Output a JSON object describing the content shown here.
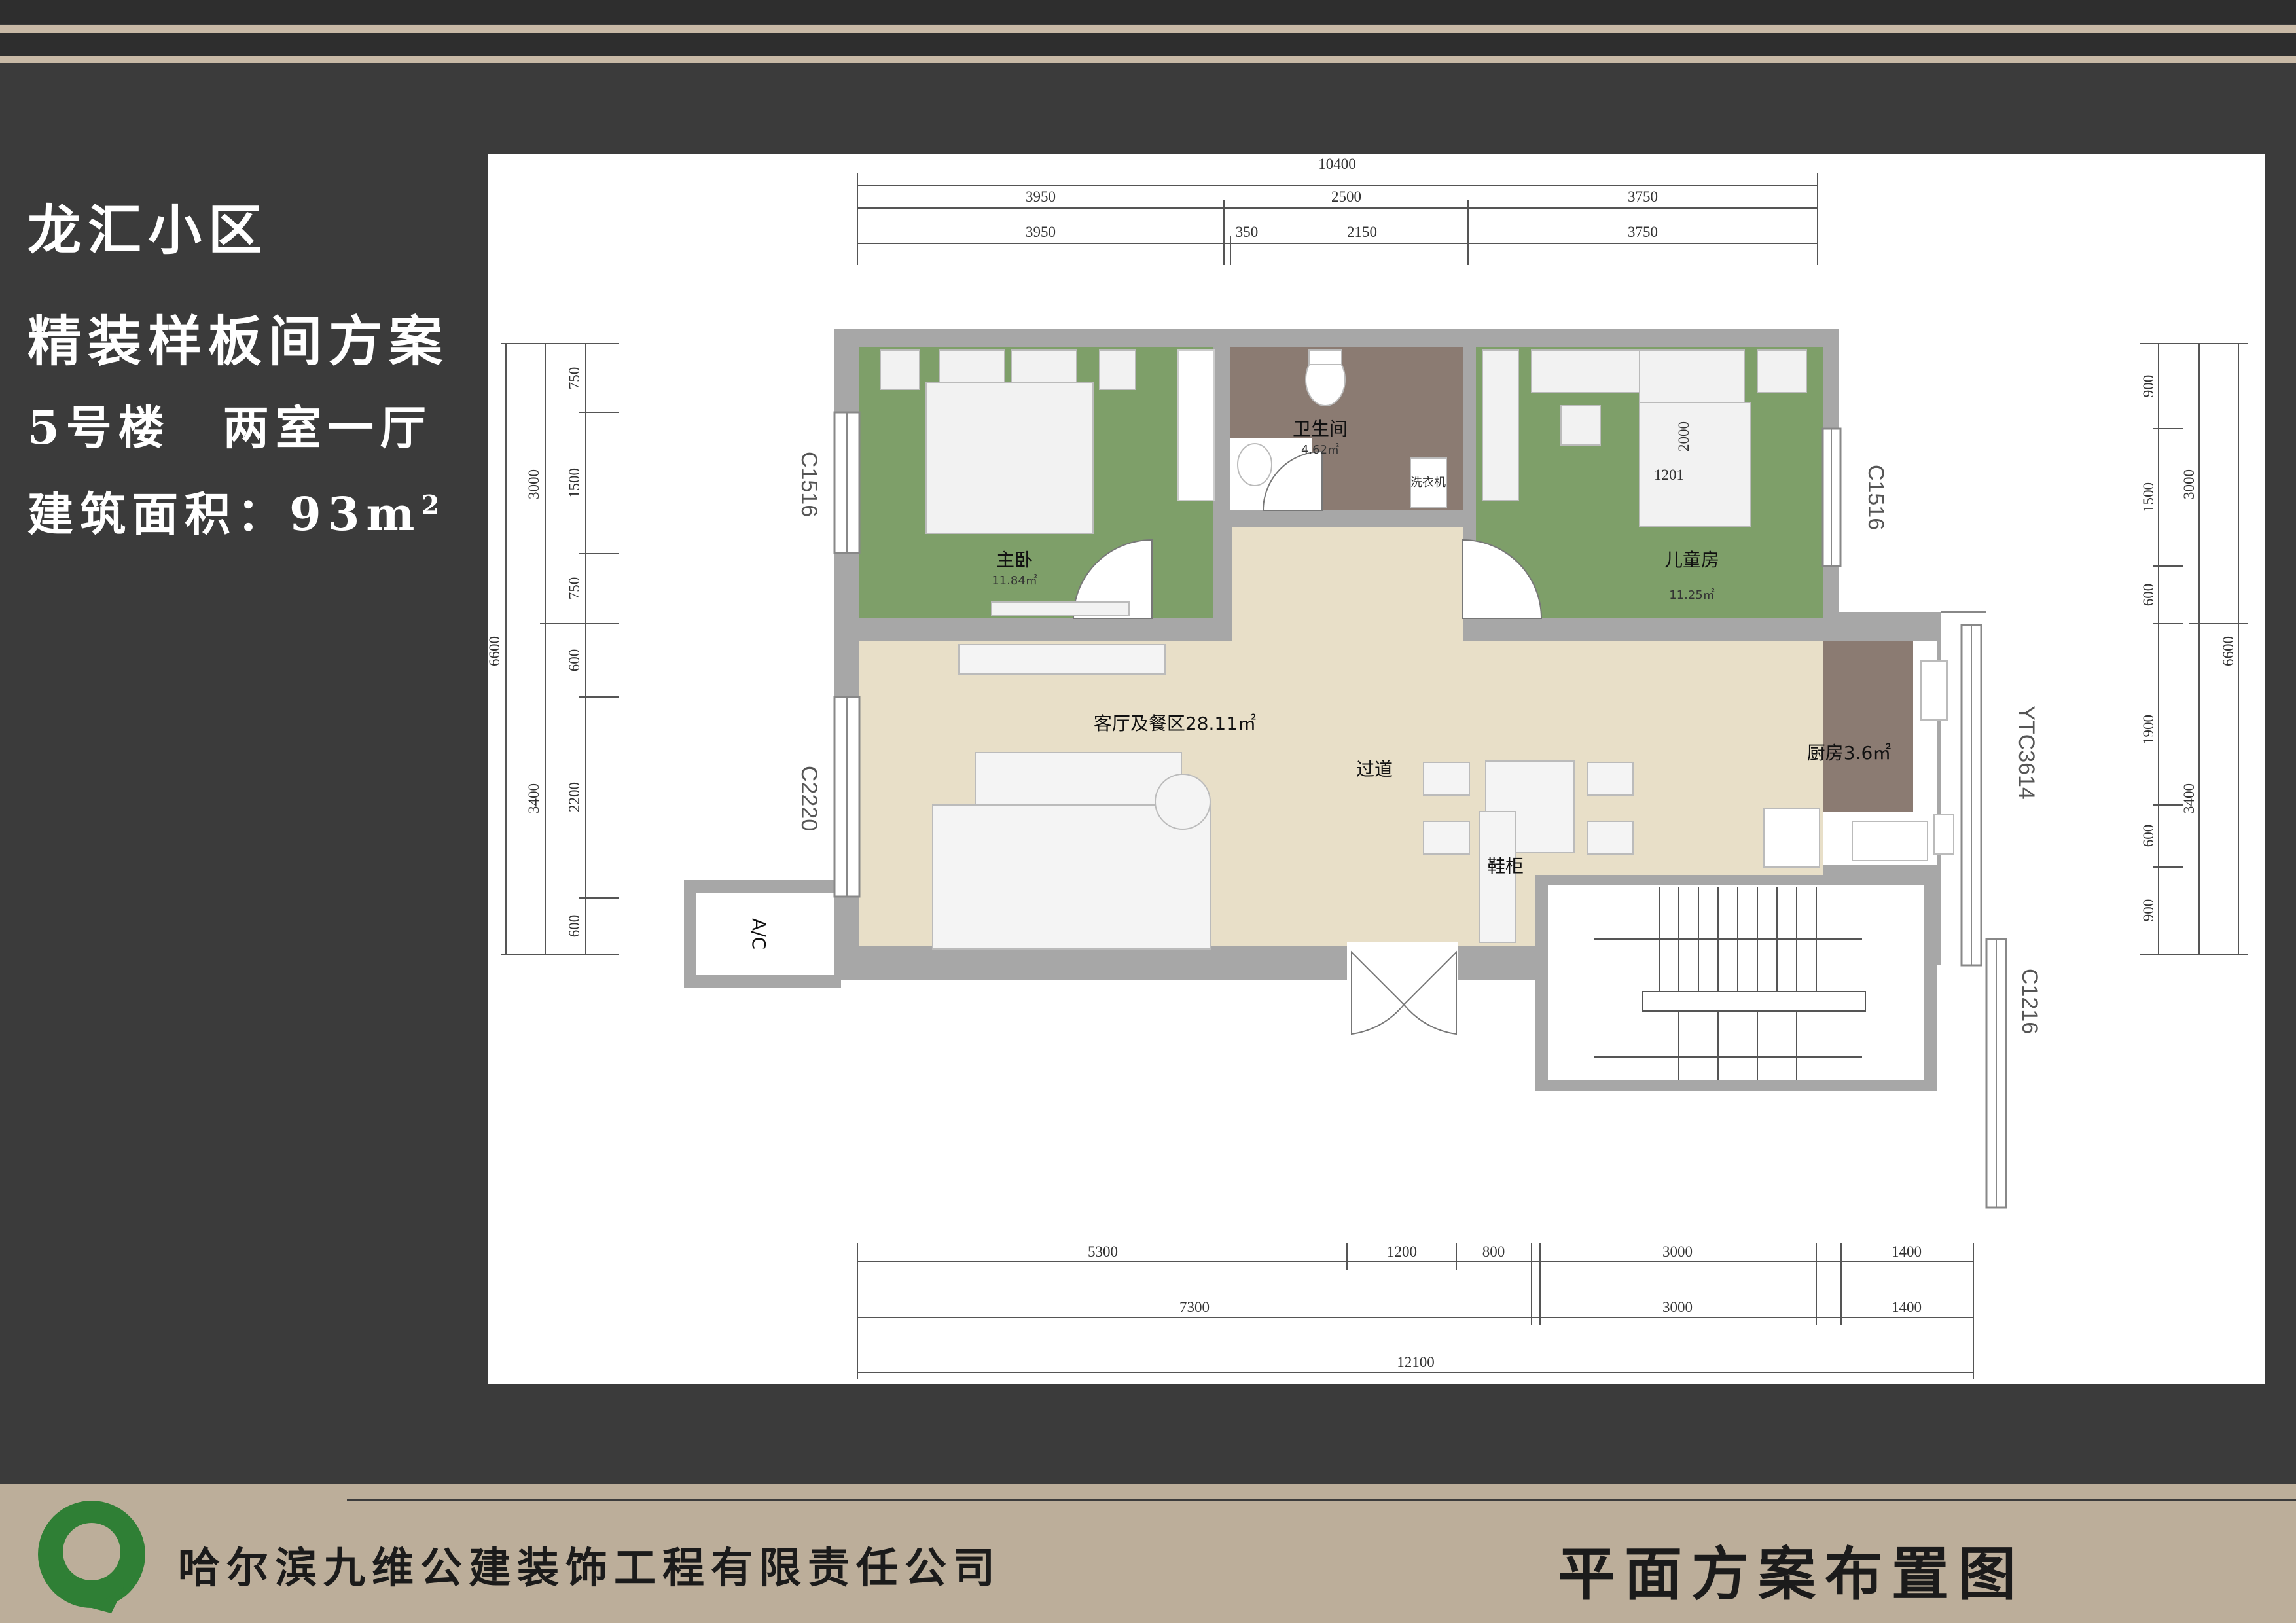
{
  "header": {
    "community": "龙汇小区",
    "scheme": "精装样板间方案",
    "building": "5号楼　两室一厅",
    "area_label": "建筑面积：93m",
    "area_sup": "2"
  },
  "footer": {
    "company": "哈尔滨九维公建装饰工程有限责任公司",
    "drawing_title": "平面方案布置图"
  },
  "rooms": {
    "master_bedroom": "主卧",
    "master_bedroom_area": "11.84㎡",
    "bathroom": "卫生间",
    "bathroom_area": "4.62㎡",
    "washer": "洗衣机",
    "kids_room": "儿童房",
    "kids_room_area": "11.25㎡",
    "bed_w": "1201",
    "bed_l": "2000",
    "living": "客厅及餐区28.11㎡",
    "corridor": "过道",
    "kitchen": "厨房3.6㎡",
    "shoe_cabinet": "鞋柜",
    "ac": "A/C"
  },
  "windows": {
    "w_left_top": "C1516",
    "w_right_top": "C1516",
    "w_left_bottom": "C2220",
    "w_right_mid": "YTC3614",
    "w_right_bottom": "C1216"
  },
  "dims_top": {
    "total": "10400",
    "r1a": "3950",
    "r1b": "2500",
    "r1c": "3750",
    "r2a": "3950",
    "r2b": "350",
    "r2c": "2150",
    "r2d": "3750"
  },
  "dims_bottom": {
    "r1a": "5300",
    "r1b": "1200",
    "r1c": "800",
    "r1d": "3000",
    "r1e": "1400",
    "r2a": "7300",
    "r2b": "3000",
    "r2c": "1400",
    "total": "12100"
  },
  "dims_left": {
    "total": "6600",
    "a1": "3000",
    "a2": "3400",
    "b1": "750",
    "b2": "1500",
    "b3": "750",
    "b4": "600",
    "b5": "2200",
    "b6": "600"
  },
  "dims_right": {
    "total": "6600",
    "a1": "3000",
    "a2": "3400",
    "b1": "900",
    "b2": "1500",
    "b3": "600",
    "b4": "1900",
    "b5": "600",
    "b6": "900"
  },
  "colors": {
    "bedroom": "#7e9f69",
    "living": "#e8dfc8",
    "bathroom": "#8b7b72",
    "kitchen": "#8b7b72",
    "wall": "#a7a7a7"
  }
}
